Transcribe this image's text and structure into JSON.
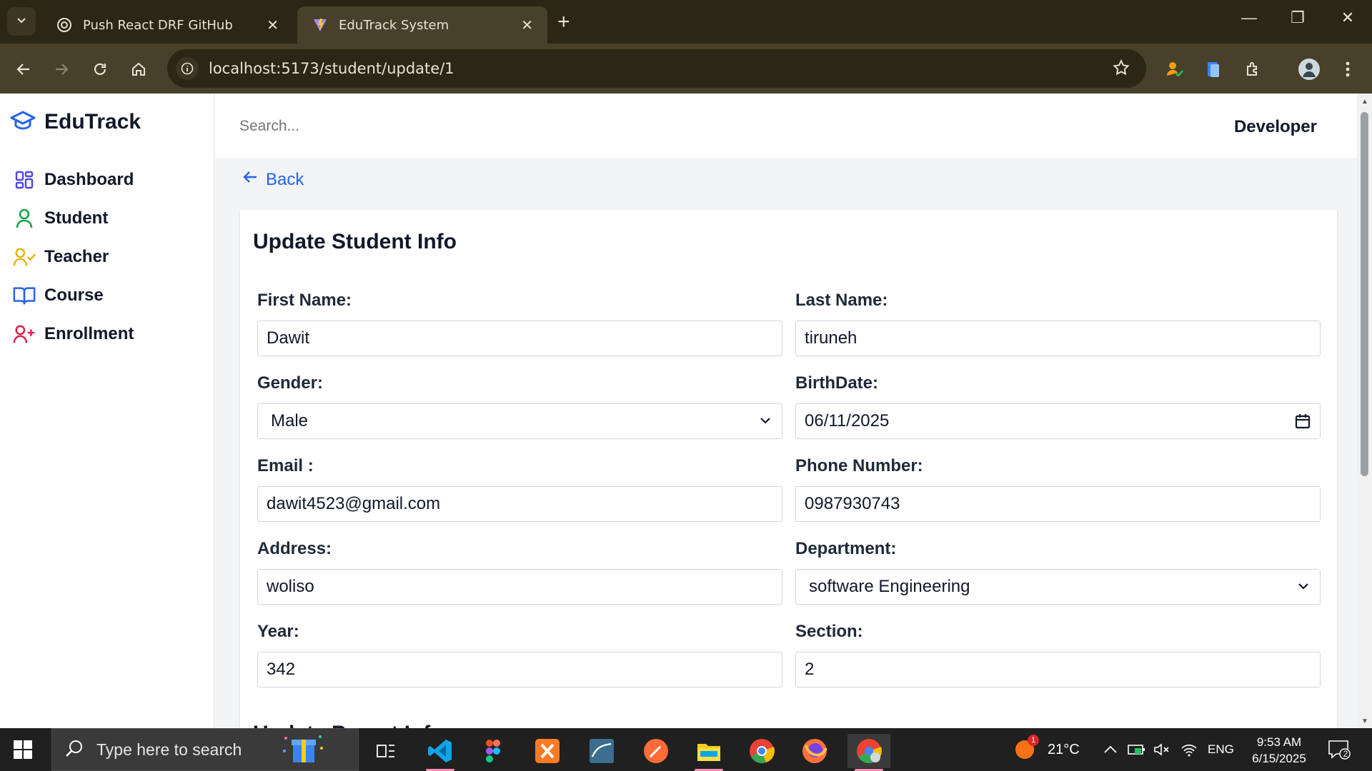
{
  "browser": {
    "tabs": [
      {
        "title": "Push React DRF GitHub",
        "active": false
      },
      {
        "title": "EduTrack System",
        "active": true
      }
    ],
    "url": "localhost:5173/student/update/1"
  },
  "app": {
    "brand": "EduTrack",
    "sidebar": {
      "items": [
        {
          "label": "Dashboard",
          "icon": "grid-icon",
          "color": "#4f46e5"
        },
        {
          "label": "Student",
          "icon": "user-icon",
          "color": "#16a34a"
        },
        {
          "label": "Teacher",
          "icon": "user-check-icon",
          "color": "#eab308"
        },
        {
          "label": "Course",
          "icon": "book-open-icon",
          "color": "#2563eb"
        },
        {
          "label": "Enrollment",
          "icon": "user-plus-icon",
          "color": "#e11d48"
        }
      ]
    },
    "header": {
      "search_placeholder": "Search...",
      "user": "Developer"
    },
    "back_label": "Back",
    "form": {
      "title": "Update Student Info",
      "first_name": {
        "label": "First Name:",
        "value": "Dawit"
      },
      "last_name": {
        "label": "Last Name:",
        "value": "tiruneh"
      },
      "gender": {
        "label": "Gender:",
        "value": "Male"
      },
      "birthdate": {
        "label": "BirthDate:",
        "value": "06/11/2025"
      },
      "email": {
        "label": "Email :",
        "value": "dawit4523@gmail.com"
      },
      "phone": {
        "label": "Phone Number:",
        "value": "0987930743"
      },
      "address": {
        "label": "Address:",
        "value": "woliso"
      },
      "department": {
        "label": "Department:",
        "value": "software Engineering"
      },
      "year": {
        "label": "Year:",
        "value": "342"
      },
      "section": {
        "label": "Section:",
        "value": "2"
      },
      "next_section_title": "Update Parent Info"
    }
  },
  "taskbar": {
    "search_placeholder": "Type here to search",
    "weather": "21°C",
    "weather_badge": "1",
    "language": "ENG",
    "time": "9:53 AM",
    "date": "6/15/2025",
    "notifications": "2"
  }
}
